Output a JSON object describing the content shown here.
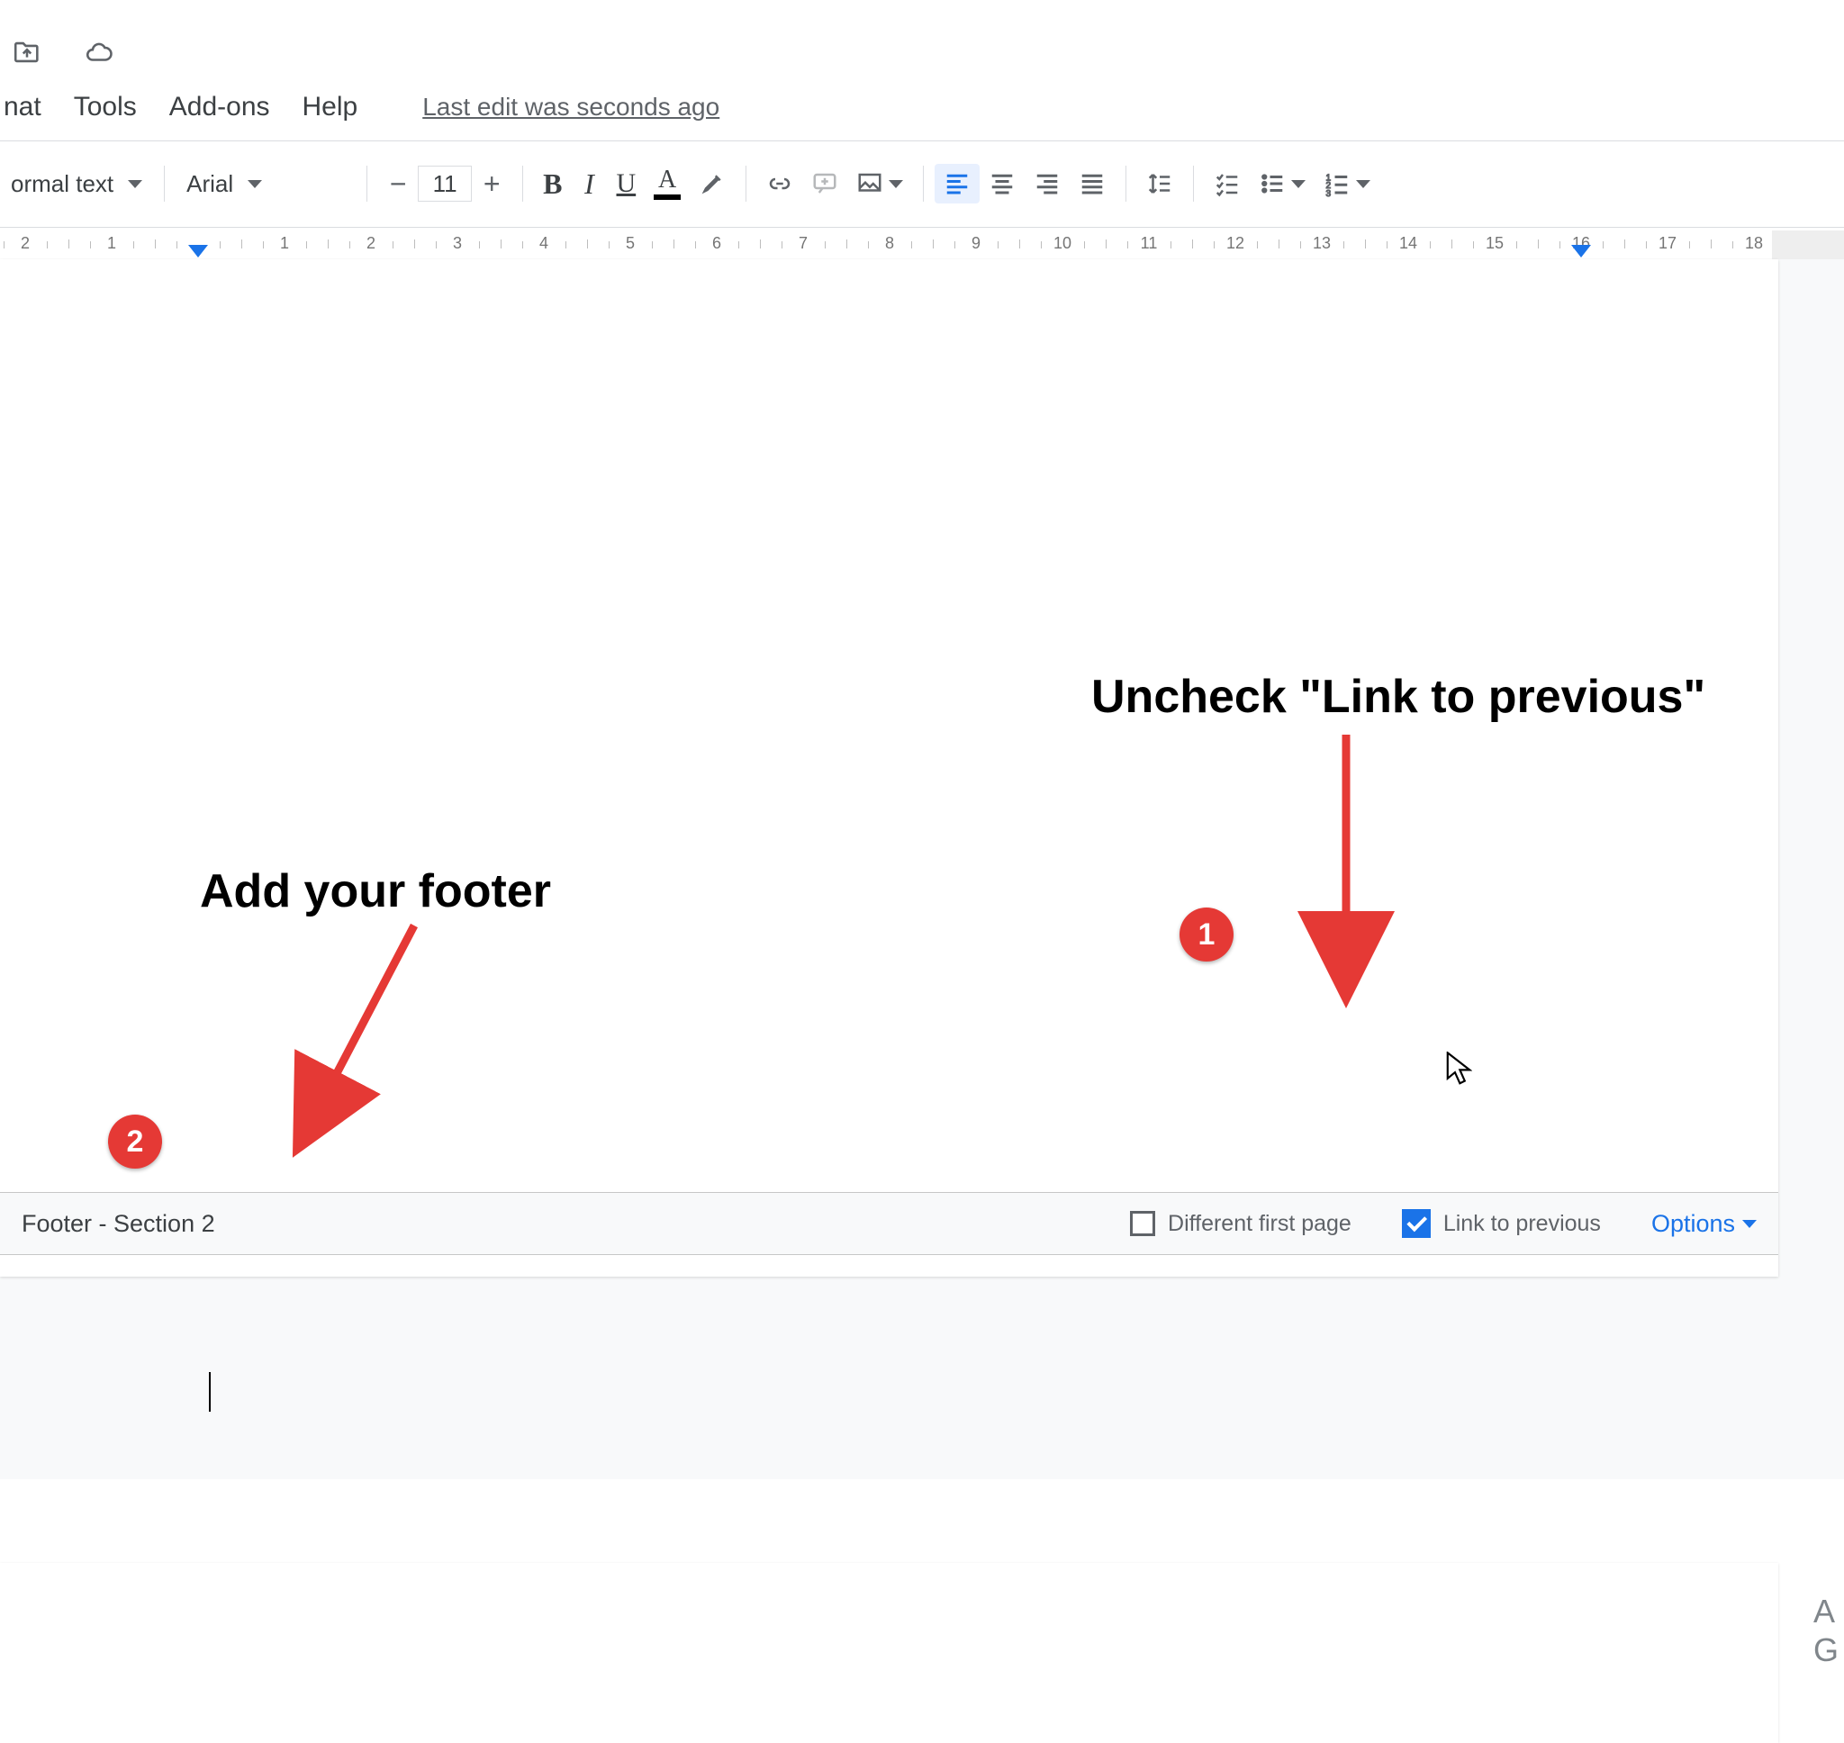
{
  "menu": {
    "format": "nat",
    "tools": "Tools",
    "addons": "Add-ons",
    "help": "Help",
    "last_edit": "Last edit was seconds ago"
  },
  "toolbar": {
    "style": "ormal text",
    "font": "Arial",
    "font_size": "11"
  },
  "ruler": {
    "numbers": [
      2,
      1,
      1,
      2,
      3,
      4,
      5,
      6,
      7,
      8,
      9,
      10,
      11,
      12,
      13,
      14,
      15,
      16,
      17,
      18
    ]
  },
  "footer": {
    "label": "Footer - Section 2",
    "different_first": "Different first page",
    "link_prev": "Link to previous",
    "options": "Options"
  },
  "annotations": {
    "uncheck": "Uncheck \"Link to previous\"",
    "addfooter": "Add your footer",
    "badges": {
      "one": "1",
      "two": "2"
    }
  },
  "side": {
    "line1": "A",
    "line2": "G"
  }
}
